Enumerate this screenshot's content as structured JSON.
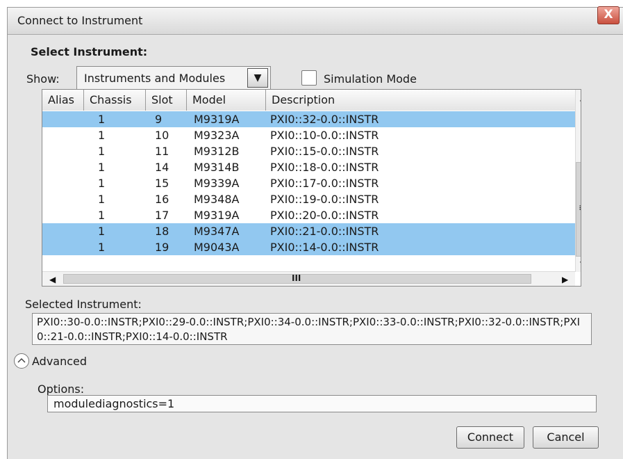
{
  "window": {
    "title": "Connect to Instrument",
    "close_label": "X"
  },
  "select_instrument": {
    "heading": "Select Instrument:",
    "show_label": "Show:",
    "show_value": "Instruments and Modules",
    "simulation_label": "Simulation Mode",
    "simulation_checked": false
  },
  "table": {
    "columns": [
      "Alias",
      "Chassis",
      "Slot",
      "Model",
      "Description"
    ],
    "rows": [
      {
        "alias": "",
        "chassis": "1",
        "slot": "9",
        "model": "M9319A",
        "description": "PXI0::32-0.0::INSTR",
        "selected": true
      },
      {
        "alias": "",
        "chassis": "1",
        "slot": "10",
        "model": "M9323A",
        "description": "PXI0::10-0.0::INSTR",
        "selected": false
      },
      {
        "alias": "",
        "chassis": "1",
        "slot": "11",
        "model": "M9312B",
        "description": "PXI0::15-0.0::INSTR",
        "selected": false
      },
      {
        "alias": "",
        "chassis": "1",
        "slot": "14",
        "model": "M9314B",
        "description": "PXI0::18-0.0::INSTR",
        "selected": false
      },
      {
        "alias": "",
        "chassis": "1",
        "slot": "15",
        "model": "M9339A",
        "description": "PXI0::17-0.0::INSTR",
        "selected": false
      },
      {
        "alias": "",
        "chassis": "1",
        "slot": "16",
        "model": "M9348A",
        "description": "PXI0::19-0.0::INSTR",
        "selected": false
      },
      {
        "alias": "",
        "chassis": "1",
        "slot": "17",
        "model": "M9319A",
        "description": "PXI0::20-0.0::INSTR",
        "selected": false
      },
      {
        "alias": "",
        "chassis": "1",
        "slot": "18",
        "model": "M9347A",
        "description": "PXI0::21-0.0::INSTR",
        "selected": true
      },
      {
        "alias": "",
        "chassis": "1",
        "slot": "19",
        "model": "M9043A",
        "description": "PXI0::14-0.0::INSTR",
        "selected": true
      }
    ]
  },
  "selected_instrument": {
    "label": "Selected Instrument:",
    "value": "PXI0::30-0.0::INSTR;PXI0::29-0.0::INSTR;PXI0::34-0.0::INSTR;PXI0::33-0.0::INSTR;PXI0::32-0.0::INSTR;PXI0::21-0.0::INSTR;PXI0::14-0.0::INSTR"
  },
  "advanced": {
    "label": "Advanced",
    "options_label": "Options:",
    "options_value": "modulediagnostics=1"
  },
  "buttons": {
    "connect": "Connect",
    "cancel": "Cancel"
  },
  "colors": {
    "selection": "#92c8f0",
    "dialog_bg": "#e5e5e5",
    "close_button": "#c9503f"
  },
  "icons": [
    "close-icon",
    "dropdown-arrow-icon",
    "scroll-up-icon",
    "scroll-down-icon",
    "scroll-thumb-grip-icon",
    "scroll-left-icon",
    "scroll-right-icon",
    "chevron-up-circle-icon"
  ]
}
